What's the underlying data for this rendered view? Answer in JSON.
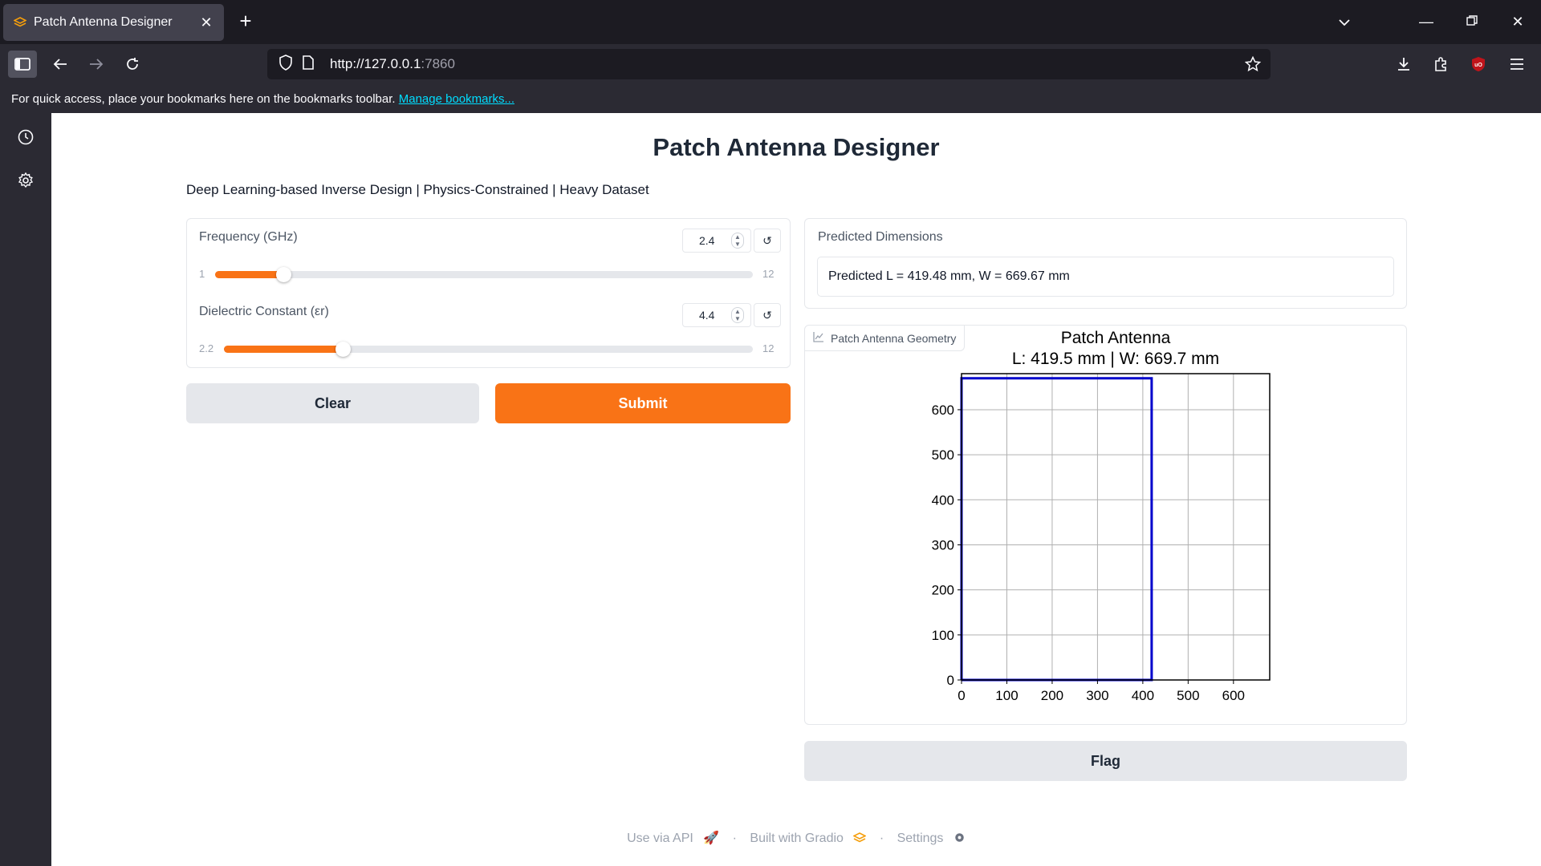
{
  "browser": {
    "tab_title": "Patch Antenna Designer",
    "url_host": "http://127.0.0.1",
    "url_port": ":7860",
    "bookmarks_text": "For quick access, place your bookmarks here on the bookmarks toolbar.",
    "bookmarks_link": "Manage bookmarks..."
  },
  "page": {
    "title": "Patch Antenna Designer",
    "subtitle": "Deep Learning-based Inverse Design | Physics-Constrained | Heavy Dataset"
  },
  "inputs": {
    "frequency": {
      "label": "Frequency (GHz)",
      "value": "2.4",
      "min": "1",
      "max": "12",
      "fraction": 0.127
    },
    "dielectric": {
      "label": "Dielectric Constant (εr)",
      "value": "4.4",
      "min": "2.2",
      "max": "12",
      "fraction": 0.224
    },
    "reset_glyph": "↺"
  },
  "buttons": {
    "clear": "Clear",
    "submit": "Submit",
    "flag": "Flag"
  },
  "output": {
    "label": "Predicted Dimensions",
    "value": "Predicted L = 419.48 mm, W = 669.67 mm",
    "plot_label": "Patch Antenna Geometry"
  },
  "chart_data": {
    "type": "line",
    "title": "Patch Antenna",
    "subtitle": "L: 419.5 mm | W: 669.7 mm",
    "xlabel": "",
    "ylabel": "",
    "xlim": [
      0,
      680
    ],
    "ylim": [
      0,
      680
    ],
    "x_ticks": [
      0,
      100,
      200,
      300,
      400,
      500,
      600
    ],
    "y_ticks": [
      0,
      100,
      200,
      300,
      400,
      500,
      600
    ],
    "grid": true,
    "series": [
      {
        "x": [
          0,
          419.5,
          419.5,
          0,
          0
        ],
        "y": [
          0,
          0,
          669.7,
          669.7,
          0
        ],
        "color": "#0000cc"
      }
    ]
  },
  "footer": {
    "api": "Use via API",
    "built": "Built with Gradio",
    "settings": "Settings",
    "sep": "·"
  },
  "colors": {
    "accent": "#f97316",
    "plot_line": "#0000cc"
  }
}
